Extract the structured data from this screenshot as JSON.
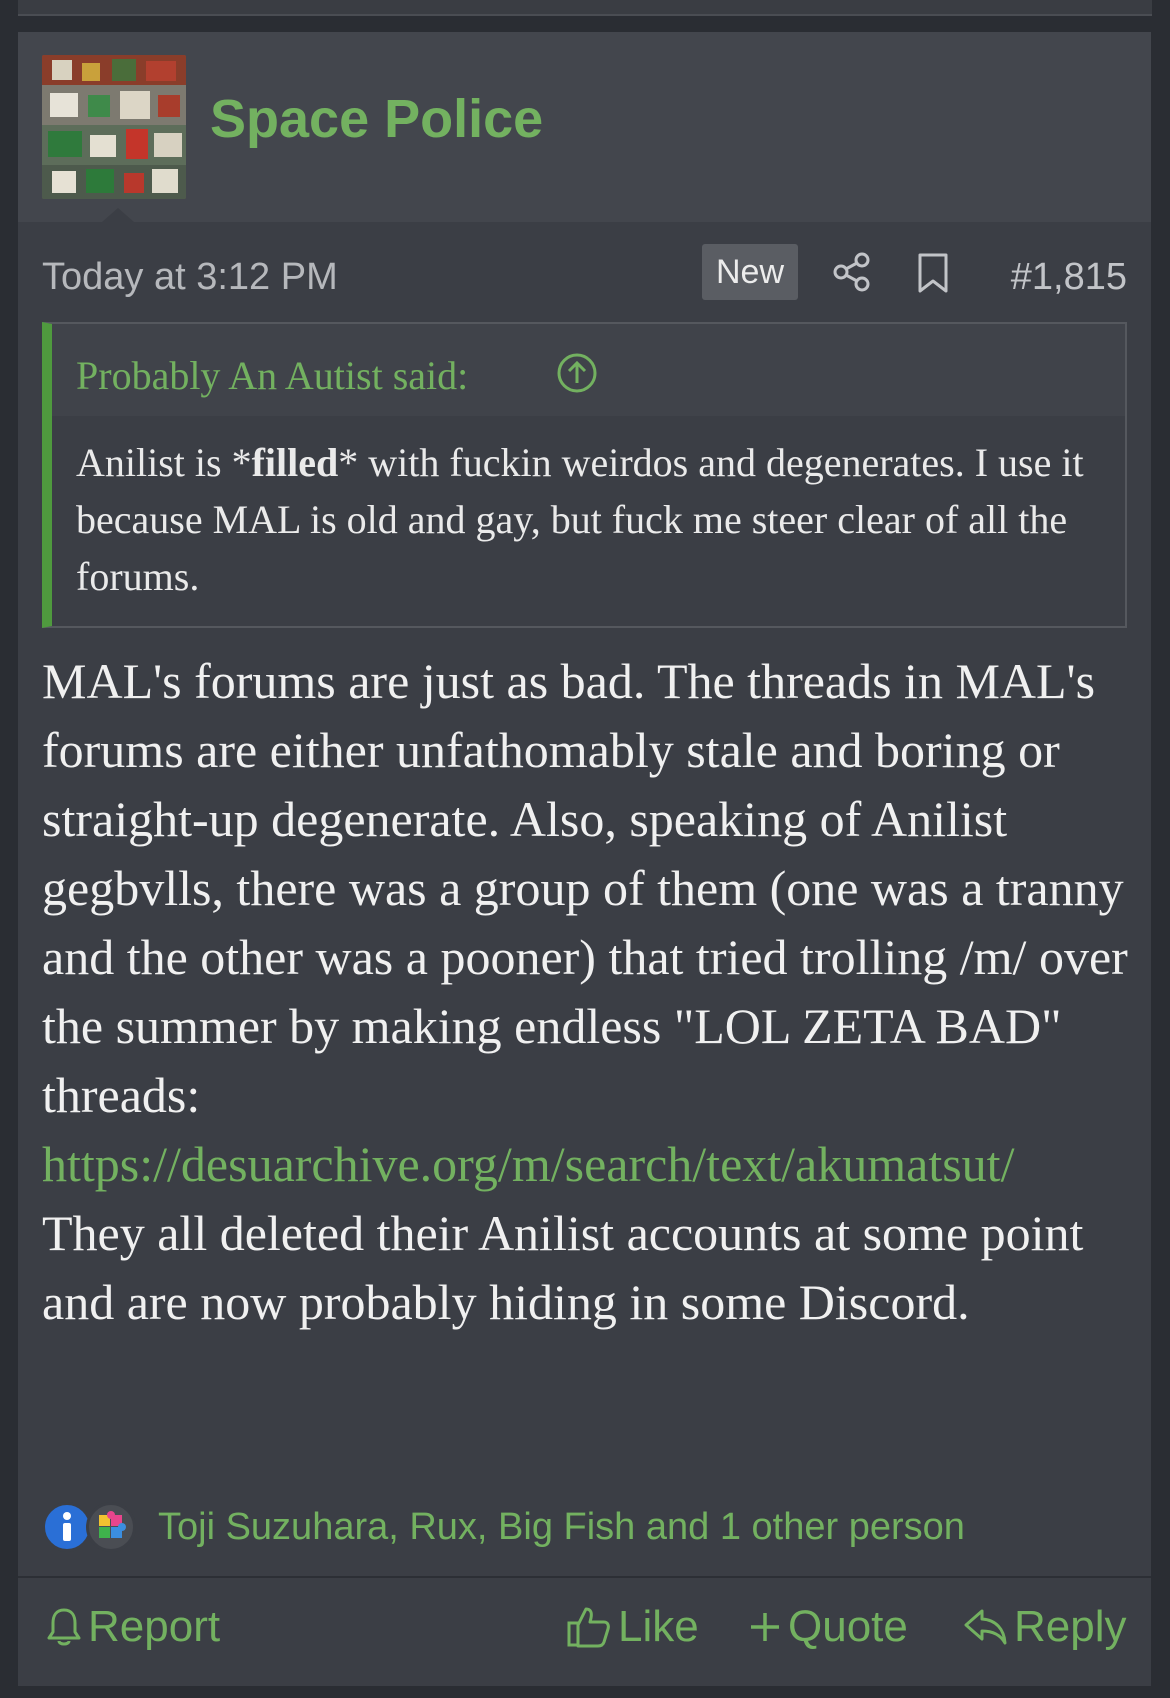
{
  "post": {
    "username": "Space Police",
    "timestamp": "Today at 3:12 PM",
    "badge": "New",
    "post_number": "#1,815",
    "quote": {
      "author": "Probably An Autist said:",
      "text_before": "Anilist is *",
      "text_bold": "filled",
      "text_after": "* with fuckin weirdos and degenerates. I use it because MAL is old and gay, but fuck me steer clear of all the forums."
    },
    "message": {
      "paragraph1": "MAL's forums are just as bad. The threads in MAL's forums are either unfathomably stale and boring or straight-up degenerate. Also, speaking of Anilist gegbvlls, there was a group of them (one was a tranny and the other was a pooner) that tried trolling /m/ over the summer by making endless \"LOL ZETA BAD\" threads:",
      "link": "https://desuarchive.org/m/search/text/akumatsut/",
      "paragraph2": "They all deleted their Anilist accounts at some point and are now probably hiding in some Discord."
    },
    "reactions": {
      "users": "Toji Suzuhara, Rux, Big Fish and 1 other person",
      "icons": [
        "info-icon",
        "puzzle-icon"
      ]
    },
    "actions": {
      "report": "Report",
      "like": "Like",
      "quote": "Quote",
      "reply": "Reply"
    },
    "colors": {
      "accent_green": "#73b160",
      "quote_border": "#4f9a3e",
      "post_bg": "#3b3e45",
      "header_bg": "#43464d"
    }
  }
}
